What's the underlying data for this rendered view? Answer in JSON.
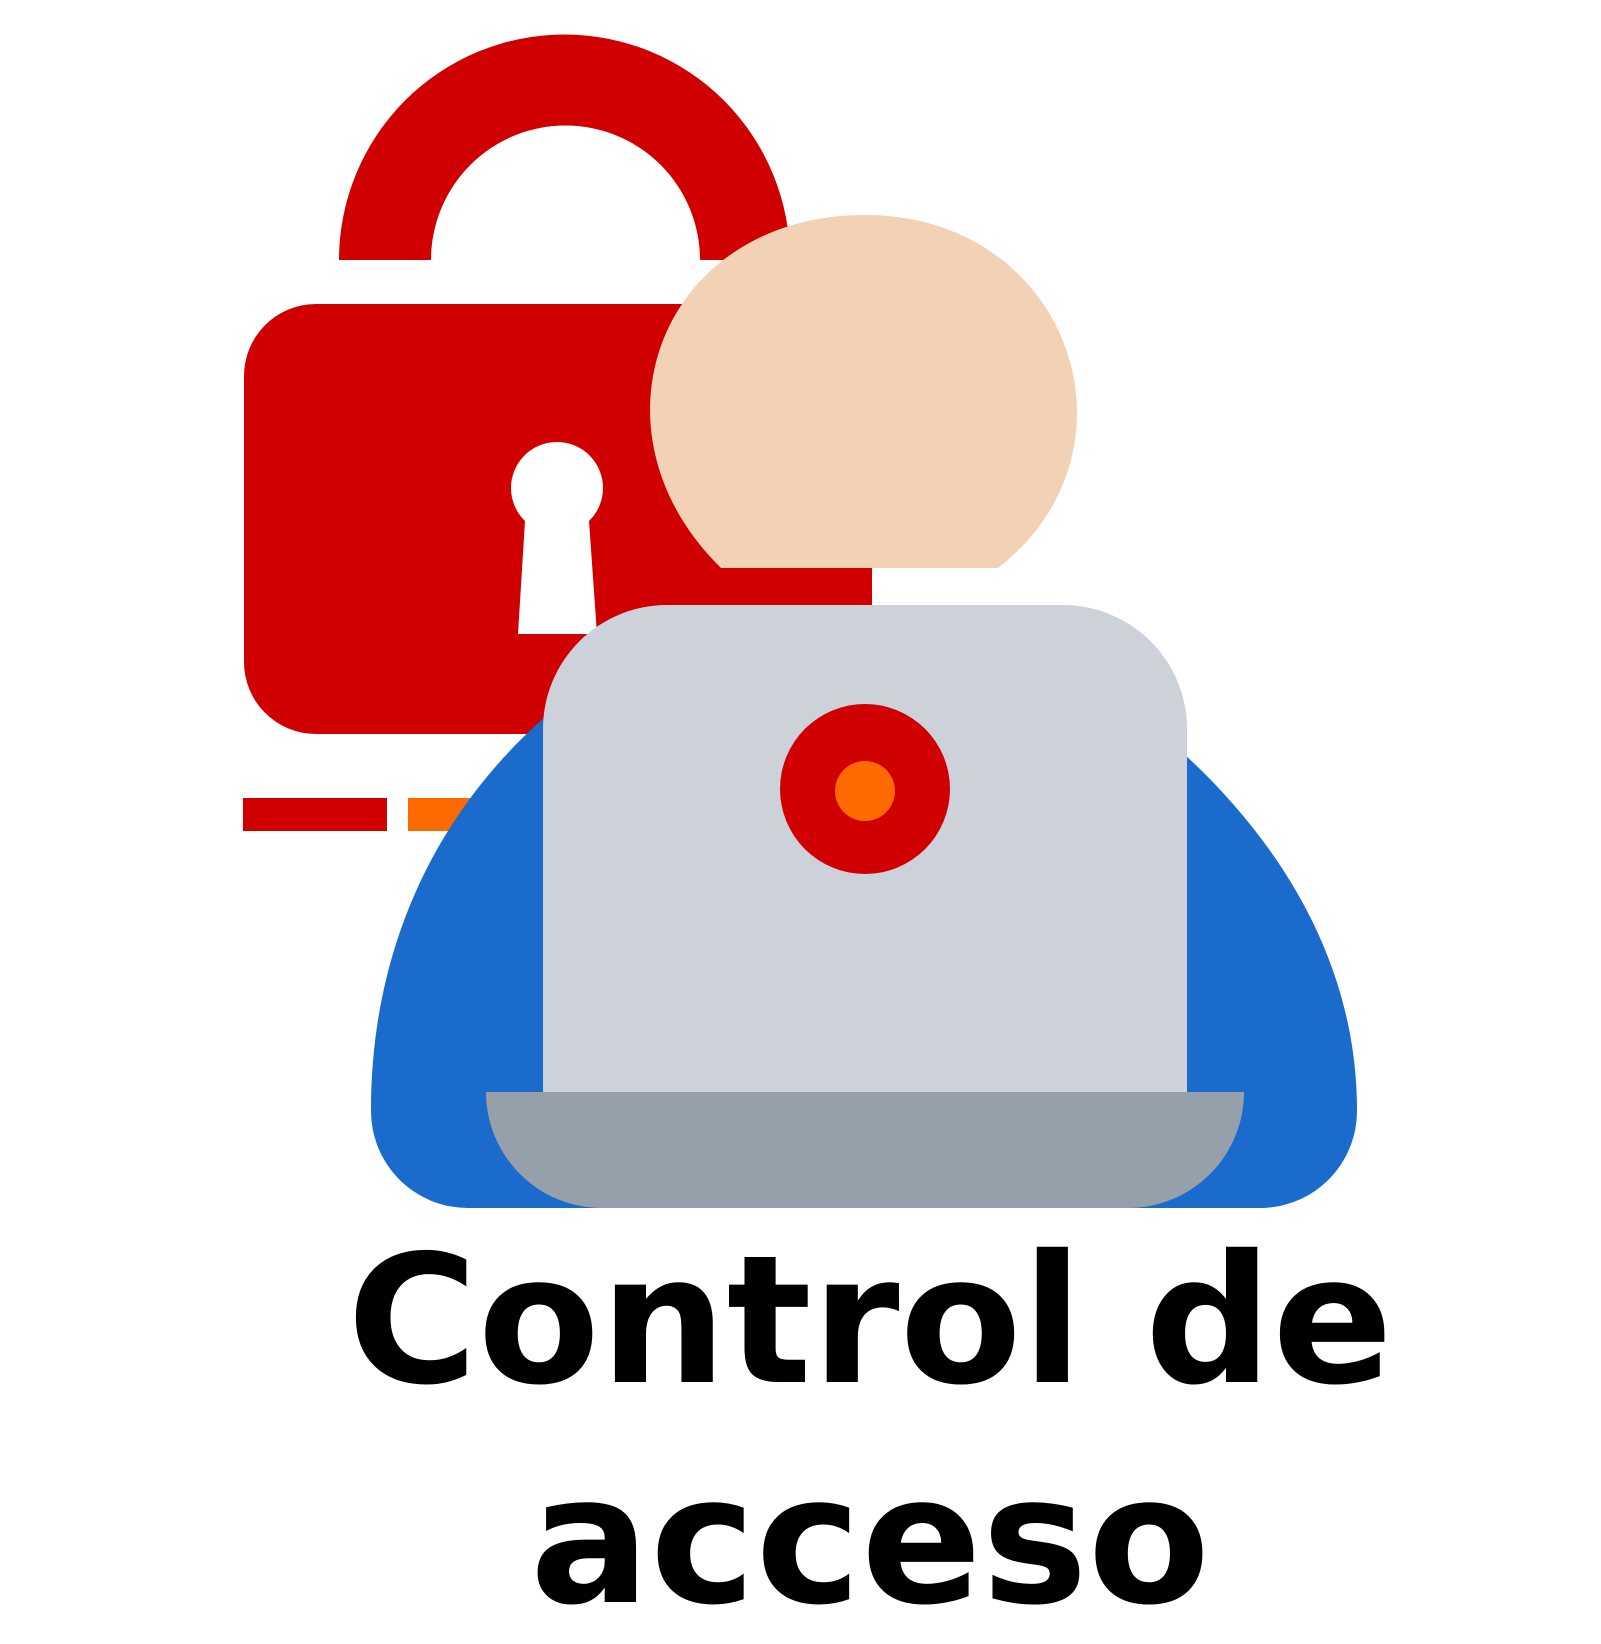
{
  "caption": {
    "line1": "Control de",
    "line2": "acceso"
  },
  "icons": {
    "padlock": "padlock-icon",
    "keyhole": "keyhole-icon",
    "person": "user-icon",
    "laptop": "laptop-icon",
    "webcam": "camera-dot-icon"
  },
  "colors": {
    "padlock_red": "#d10000",
    "accent_orange": "#ff6a00",
    "skin": "#f2d1b5",
    "shirt_blue": "#1a6bcb",
    "laptop_lid": "#cdd1da",
    "laptop_base": "#96a0ab",
    "text": "#000000"
  }
}
